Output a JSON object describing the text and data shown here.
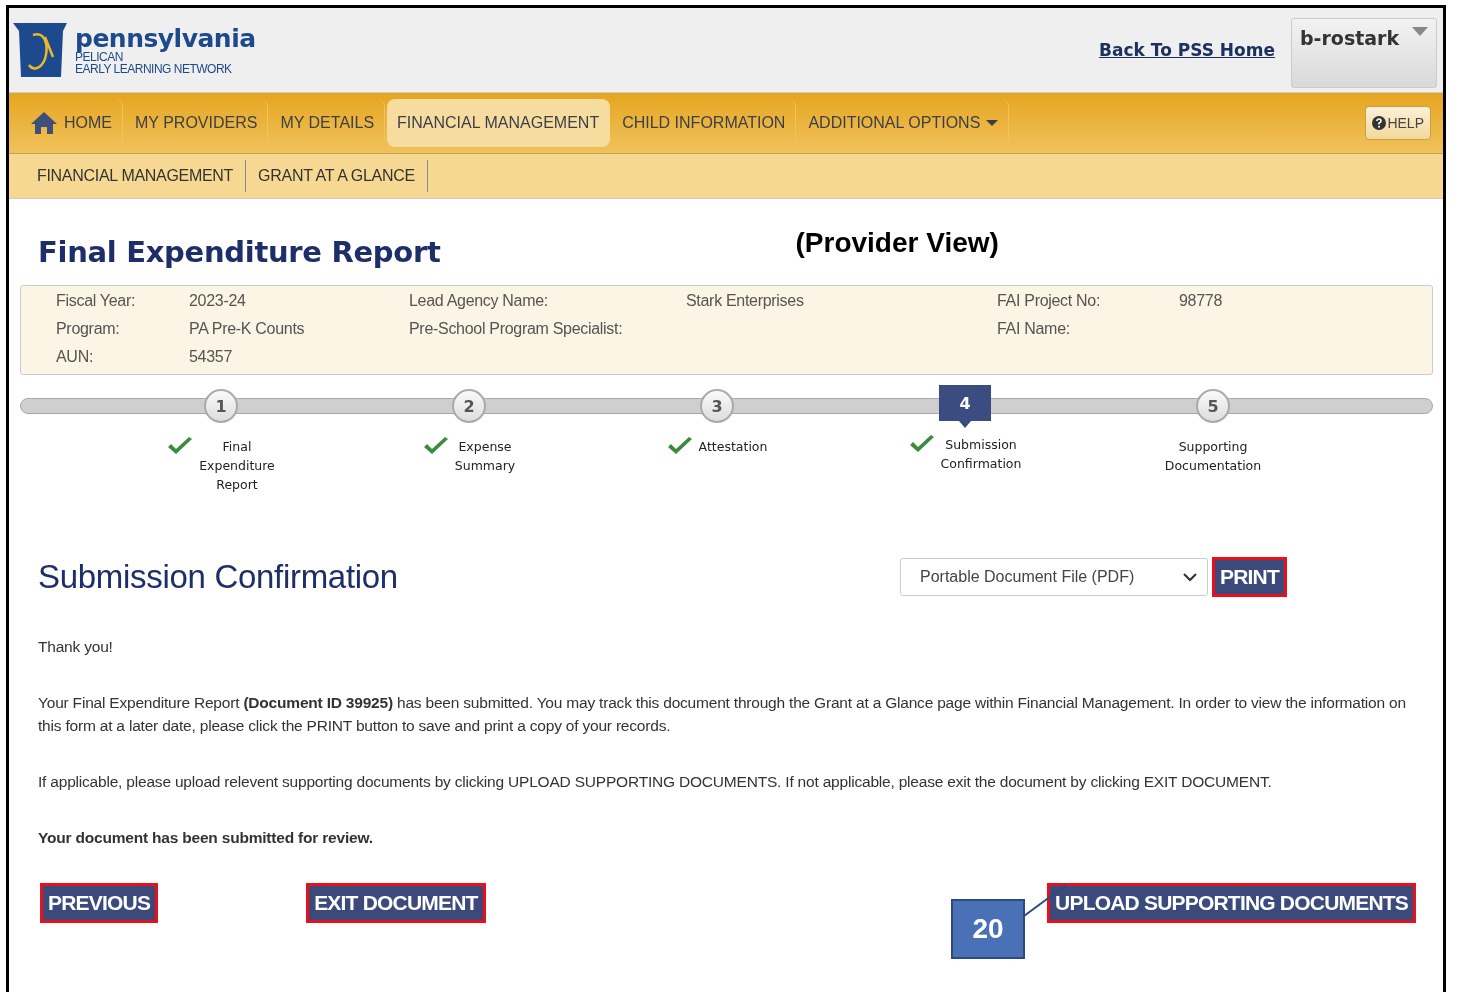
{
  "header": {
    "logo_title": "pennsylvania",
    "logo_line1": "PELICAN",
    "logo_line2": "EARLY LEARNING NETWORK",
    "home_link": "Back To PSS Home",
    "user": "b-rostark"
  },
  "nav": {
    "items": [
      {
        "label": "HOME",
        "kind": "home",
        "selected": false
      },
      {
        "label": "MY PROVIDERS",
        "kind": "plain",
        "selected": false
      },
      {
        "label": "MY DETAILS",
        "kind": "plain",
        "selected": false
      },
      {
        "label": "FINANCIAL MANAGEMENT",
        "kind": "plain",
        "selected": true
      },
      {
        "label": "CHILD INFORMATION",
        "kind": "plain",
        "selected": false
      },
      {
        "label": "ADDITIONAL OPTIONS",
        "kind": "dropdown",
        "selected": false
      }
    ],
    "help": "HELP"
  },
  "subnav": [
    "FINANCIAL MANAGEMENT",
    "GRANT AT A GLANCE"
  ],
  "page_title": "Final Expenditure Report",
  "annotation": "(Provider View)",
  "info_panel": {
    "columns": [
      [
        {
          "label": "Fiscal Year:",
          "value": "2023-24"
        },
        {
          "label": "Program:",
          "value": "PA Pre-K Counts"
        },
        {
          "label": "AUN:",
          "value": "54357"
        }
      ],
      [
        {
          "label": "Lead Agency Name:",
          "value": "Stark Enterprises"
        },
        {
          "label": "Pre-School Program Specialist:"
        }
      ],
      [
        {
          "label": "FAI Project No:",
          "value": "98778"
        },
        {
          "label": "FAI Name:"
        }
      ]
    ]
  },
  "steps": [
    {
      "number": "1",
      "label": "Final\nExpenditure\nReport",
      "completed": true,
      "selected": false
    },
    {
      "number": "2",
      "label": "Expense\nSummary",
      "completed": true,
      "selected": false
    },
    {
      "number": "3",
      "label": "Attestation",
      "completed": true,
      "selected": false
    },
    {
      "number": "4",
      "label": "Submission\nConfirmation",
      "completed": true,
      "selected": true
    },
    {
      "number": "5",
      "label": "Supporting\nDocumentation",
      "completed": false,
      "selected": false
    }
  ],
  "section": {
    "heading": "Submission Confirmation",
    "format_select": "Portable Document File (PDF)",
    "print_button": {
      "label": "PRINT",
      "highlighted": true
    }
  },
  "paragraphs": [
    {
      "text": "Thank you!",
      "bold": false
    },
    {
      "text": "Your Final Expenditure Report **(Document ID 39925)** has been submitted. You may track this document through the Grant at a Glance page within Financial Management. In order to view the information on this form at a later date, please click the PRINT button to save and print a copy of your records.",
      "bold": false
    },
    {
      "text": "If applicable, please upload relevent supporting documents by clicking UPLOAD SUPPORTING DOCUMENTS. If not applicable, please exit the document by clicking EXIT DOCUMENT.",
      "bold": false
    },
    {
      "text": "Your document has been submitted for review.",
      "bold": true
    }
  ],
  "buttons": [
    {
      "label": "PREVIOUS",
      "highlighted": true
    },
    {
      "label": "EXIT DOCUMENT",
      "highlighted": true
    },
    {
      "label": "UPLOAD SUPPORTING DOCUMENTS",
      "highlighted": true
    }
  ],
  "callout": "20"
}
